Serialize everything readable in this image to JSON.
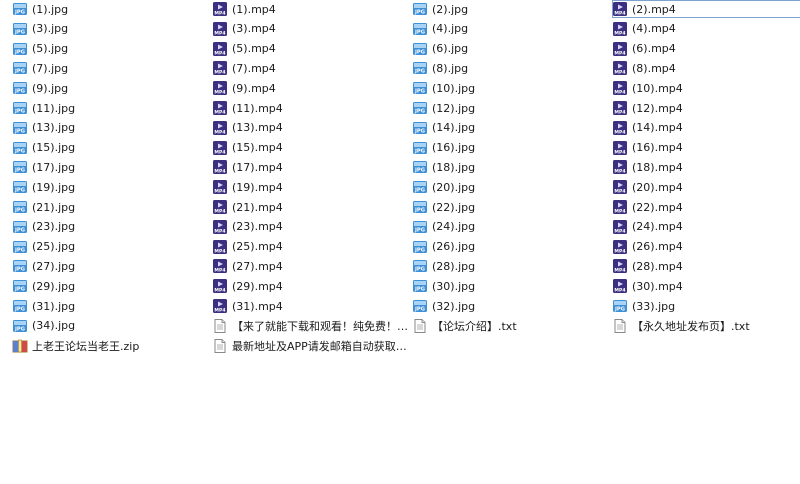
{
  "columns": [
    {
      "items": [
        {
          "name": "(1).jpg",
          "type": "jpg"
        },
        {
          "name": "(3).jpg",
          "type": "jpg"
        },
        {
          "name": "(5).jpg",
          "type": "jpg"
        },
        {
          "name": "(7).jpg",
          "type": "jpg"
        },
        {
          "name": "(9).jpg",
          "type": "jpg"
        },
        {
          "name": "(11).jpg",
          "type": "jpg"
        },
        {
          "name": "(13).jpg",
          "type": "jpg"
        },
        {
          "name": "(15).jpg",
          "type": "jpg"
        },
        {
          "name": "(17).jpg",
          "type": "jpg"
        },
        {
          "name": "(19).jpg",
          "type": "jpg"
        },
        {
          "name": "(21).jpg",
          "type": "jpg"
        },
        {
          "name": "(23).jpg",
          "type": "jpg"
        },
        {
          "name": "(25).jpg",
          "type": "jpg"
        },
        {
          "name": "(27).jpg",
          "type": "jpg"
        },
        {
          "name": "(29).jpg",
          "type": "jpg"
        },
        {
          "name": "(31).jpg",
          "type": "jpg"
        },
        {
          "name": "(34).jpg",
          "type": "jpg"
        },
        {
          "name": "上老王论坛当老王.zip",
          "type": "zip"
        }
      ]
    },
    {
      "items": [
        {
          "name": "(1).mp4",
          "type": "mp4"
        },
        {
          "name": "(3).mp4",
          "type": "mp4"
        },
        {
          "name": "(5).mp4",
          "type": "mp4"
        },
        {
          "name": "(7).mp4",
          "type": "mp4"
        },
        {
          "name": "(9).mp4",
          "type": "mp4"
        },
        {
          "name": "(11).mp4",
          "type": "mp4"
        },
        {
          "name": "(13).mp4",
          "type": "mp4"
        },
        {
          "name": "(15).mp4",
          "type": "mp4"
        },
        {
          "name": "(17).mp4",
          "type": "mp4"
        },
        {
          "name": "(19).mp4",
          "type": "mp4"
        },
        {
          "name": "(21).mp4",
          "type": "mp4"
        },
        {
          "name": "(23).mp4",
          "type": "mp4"
        },
        {
          "name": "(25).mp4",
          "type": "mp4"
        },
        {
          "name": "(27).mp4",
          "type": "mp4"
        },
        {
          "name": "(29).mp4",
          "type": "mp4"
        },
        {
          "name": "(31).mp4",
          "type": "mp4"
        },
        {
          "name": "【来了就能下载和观看！纯免费！】...",
          "type": "txt"
        },
        {
          "name": "最新地址及APP请发邮箱自动获取！...",
          "type": "txt"
        }
      ]
    },
    {
      "items": [
        {
          "name": "(2).jpg",
          "type": "jpg"
        },
        {
          "name": "(4).jpg",
          "type": "jpg"
        },
        {
          "name": "(6).jpg",
          "type": "jpg"
        },
        {
          "name": "(8).jpg",
          "type": "jpg"
        },
        {
          "name": "(10).jpg",
          "type": "jpg"
        },
        {
          "name": "(12).jpg",
          "type": "jpg"
        },
        {
          "name": "(14).jpg",
          "type": "jpg"
        },
        {
          "name": "(16).jpg",
          "type": "jpg"
        },
        {
          "name": "(18).jpg",
          "type": "jpg"
        },
        {
          "name": "(20).jpg",
          "type": "jpg"
        },
        {
          "name": "(22).jpg",
          "type": "jpg"
        },
        {
          "name": "(24).jpg",
          "type": "jpg"
        },
        {
          "name": "(26).jpg",
          "type": "jpg"
        },
        {
          "name": "(28).jpg",
          "type": "jpg"
        },
        {
          "name": "(30).jpg",
          "type": "jpg"
        },
        {
          "name": "(32).jpg",
          "type": "jpg"
        },
        {
          "name": "【论坛介绍】.txt",
          "type": "txt"
        }
      ]
    },
    {
      "items": [
        {
          "name": "(2).mp4",
          "type": "mp4",
          "selected": true
        },
        {
          "name": "(4).mp4",
          "type": "mp4"
        },
        {
          "name": "(6).mp4",
          "type": "mp4"
        },
        {
          "name": "(8).mp4",
          "type": "mp4"
        },
        {
          "name": "(10).mp4",
          "type": "mp4"
        },
        {
          "name": "(12).mp4",
          "type": "mp4"
        },
        {
          "name": "(14).mp4",
          "type": "mp4"
        },
        {
          "name": "(16).mp4",
          "type": "mp4"
        },
        {
          "name": "(18).mp4",
          "type": "mp4"
        },
        {
          "name": "(20).mp4",
          "type": "mp4"
        },
        {
          "name": "(22).mp4",
          "type": "mp4"
        },
        {
          "name": "(24).mp4",
          "type": "mp4"
        },
        {
          "name": "(26).mp4",
          "type": "mp4"
        },
        {
          "name": "(28).mp4",
          "type": "mp4"
        },
        {
          "name": "(30).mp4",
          "type": "mp4"
        },
        {
          "name": "(33).jpg",
          "type": "jpg"
        },
        {
          "name": "【永久地址发布页】.txt",
          "type": "txt"
        }
      ]
    }
  ],
  "icon_names": {
    "jpg": "jpg-file-icon",
    "mp4": "mp4-video-file-icon",
    "txt": "text-file-icon",
    "zip": "zip-archive-icon"
  },
  "icon_text": {
    "jpg": "JPG",
    "mp4": "MP4"
  },
  "colors": {
    "jpg": "#3d8fd6",
    "mp4": "#3b2f80",
    "selection": "#7da2ce"
  }
}
